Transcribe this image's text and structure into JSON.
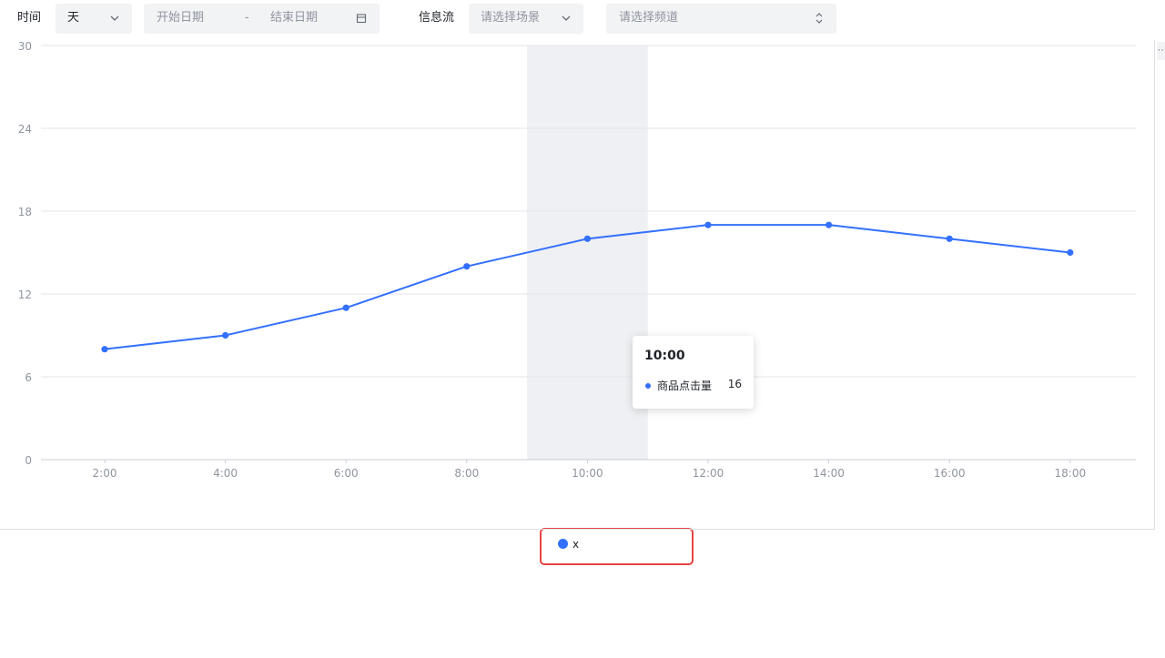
{
  "filters": {
    "time_label": "时间",
    "granularity_value": "天",
    "start_date_placeholder": "开始日期",
    "date_separator": "-",
    "end_date_placeholder": "结束日期",
    "feed_label": "信息流",
    "scene_placeholder": "请选择场景",
    "channel_placeholder": "请选择频道"
  },
  "icons": {
    "granularity_dropdown": "chevron-down-icon",
    "calendar": "calendar-icon",
    "scene_dropdown": "chevron-down-icon",
    "channel_sort": "chevron-up-down-icon"
  },
  "tooltip": {
    "title": "10:00",
    "series_name": "商品点击量",
    "value": "16"
  },
  "legend": {
    "label": "x"
  },
  "colors": {
    "series": "#3370ff",
    "highlight_band": "#eff0f3",
    "legend_highlight_border": "#e54545"
  },
  "chart_data": {
    "type": "line",
    "x": [
      "2:00",
      "4:00",
      "6:00",
      "8:00",
      "10:00",
      "12:00",
      "14:00",
      "16:00",
      "18:00"
    ],
    "series": [
      {
        "name": "x",
        "values": [
          8,
          9,
          11,
          14,
          16,
          17,
          17,
          16,
          15
        ]
      }
    ],
    "ylim": [
      0,
      30
    ],
    "yticks": [
      "0",
      "6",
      "12",
      "18",
      "24",
      "30"
    ],
    "grid": true,
    "highlighted_category": "10:00",
    "legend_position": "bottom"
  }
}
